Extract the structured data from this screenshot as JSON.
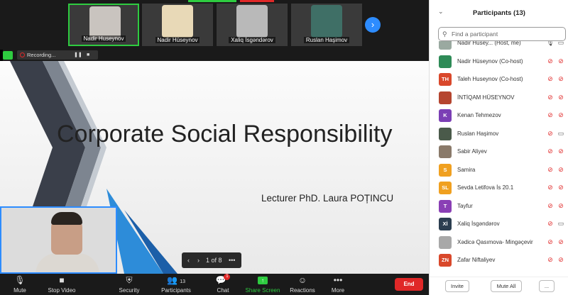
{
  "video_strip": {
    "tiles": [
      {
        "name": "Nadir Huseynov"
      },
      {
        "name": "Nadir Hüseynov"
      },
      {
        "name": "Xaliq İsgəndərov"
      },
      {
        "name": "Ruslan Haşimov"
      }
    ],
    "next_icon": "chevron-right-icon"
  },
  "recording": {
    "label": "Recording...",
    "pause_icon": "pause-icon",
    "stop_icon": "stop-icon"
  },
  "slide": {
    "title": "Corporate Social Responsibility",
    "lecturer": "Lecturer PhD. Laura POȚINCU"
  },
  "pager": {
    "label": "1 of 8",
    "more": "•••"
  },
  "toolbar": {
    "mute": "Mute",
    "stop_video": "Stop Video",
    "security": "Security",
    "participants": "Participants",
    "participants_count": "13",
    "chat": "Chat",
    "chat_badge": "1",
    "share_screen": "Share Screen",
    "reactions": "Reactions",
    "more": "More",
    "end": "End"
  },
  "panel": {
    "title": "Participants (13)",
    "search_placeholder": "Find a participant",
    "participants": [
      {
        "name": "Nadir Husey... (Host, me)",
        "initials": "",
        "color": "#9aa9a0",
        "mic": "on",
        "cam": "on"
      },
      {
        "name": "Nadir Hüseynov (Co-host)",
        "initials": "",
        "color": "#2e8b57",
        "mic": "off",
        "cam": "off"
      },
      {
        "name": "Taleh Huseynov (Co-host)",
        "initials": "TH",
        "color": "#d9482b",
        "mic": "off",
        "cam": "off"
      },
      {
        "name": "İNTİQAM HÜSEYNOV",
        "initials": "",
        "color": "#b5452f",
        "mic": "off",
        "cam": "off"
      },
      {
        "name": "Kenan Tehmezov",
        "initials": "K",
        "color": "#7b3fb5",
        "mic": "off",
        "cam": "off"
      },
      {
        "name": "Ruslan Haşimov",
        "initials": "",
        "color": "#4a5a4a",
        "mic": "off",
        "cam": "on"
      },
      {
        "name": "Sabir Aliyev",
        "initials": "",
        "color": "#8a7a6a",
        "mic": "off",
        "cam": "off"
      },
      {
        "name": "Samira",
        "initials": "S",
        "color": "#f0a020",
        "mic": "off",
        "cam": "off"
      },
      {
        "name": "Sevda Letifova İs 20.1",
        "initials": "SL",
        "color": "#f0a020",
        "mic": "off",
        "cam": "off"
      },
      {
        "name": "Tayfur",
        "initials": "T",
        "color": "#8a3fb5",
        "mic": "off",
        "cam": "off"
      },
      {
        "name": "Xaliq İsgəndərov",
        "initials": "Xİ",
        "color": "#2c3e50",
        "mic": "off",
        "cam": "on"
      },
      {
        "name": "Xədicə Qasımova- Mingəçevir",
        "initials": "",
        "color": "#a8a8a8",
        "mic": "off",
        "cam": "off"
      },
      {
        "name": "Zafar Niftaliyev",
        "initials": "ZN",
        "color": "#d9482b",
        "mic": "off",
        "cam": "off"
      }
    ],
    "invite": "Invite",
    "mute_all": "Mute All",
    "more": "..."
  }
}
